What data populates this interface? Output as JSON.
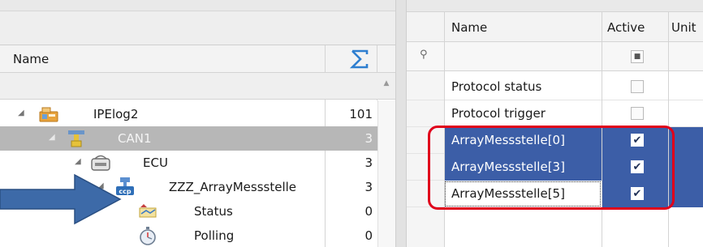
{
  "tree_panel": {
    "column_name": "Name",
    "sum_symbol": "Σ",
    "rows": [
      {
        "label": "IPElog2",
        "count": "101",
        "icon": "logger-device-icon",
        "expanded": true,
        "selected": false
      },
      {
        "label": "CAN1",
        "count": "3",
        "icon": "can-bus-icon",
        "expanded": true,
        "selected": true
      },
      {
        "label": "ECU",
        "count": "3",
        "icon": "ecu-icon",
        "expanded": true,
        "selected": false
      },
      {
        "label": "ZZZ_ArrayMessstelle",
        "count": "3",
        "icon": "ccp-protocol-icon",
        "expanded": true,
        "selected": false
      },
      {
        "label": "Status",
        "count": "0",
        "icon": "status-icon",
        "expanded": false,
        "selected": false
      },
      {
        "label": "Polling",
        "count": "0",
        "icon": "stopwatch-icon",
        "expanded": false,
        "selected": false
      }
    ]
  },
  "grid_panel": {
    "columns": {
      "name": "Name",
      "active": "Active",
      "unit": "Unit"
    },
    "filter_row": {
      "pin_icon": "pin-icon",
      "checkbox_glyph": "■"
    },
    "rows": [
      {
        "name": "Protocol status",
        "active": false,
        "state": "normal"
      },
      {
        "name": "Protocol trigger",
        "active": false,
        "state": "normal"
      },
      {
        "name": "ArrayMessstelle[0]",
        "active": true,
        "state": "selected"
      },
      {
        "name": "ArrayMessstelle[3]",
        "active": true,
        "state": "selected"
      },
      {
        "name": "ArrayMessstelle[5]",
        "active": true,
        "state": "focused"
      }
    ],
    "check_glyph": "✔"
  },
  "annotations": {
    "arrow_color": "#3d6aa8",
    "highlight_color": "#e0001b"
  },
  "colors": {
    "selection_blue": "#3c5ea7",
    "tree_selection_gray": "#b7b7b7",
    "sum_blue": "#2f7fd0"
  }
}
